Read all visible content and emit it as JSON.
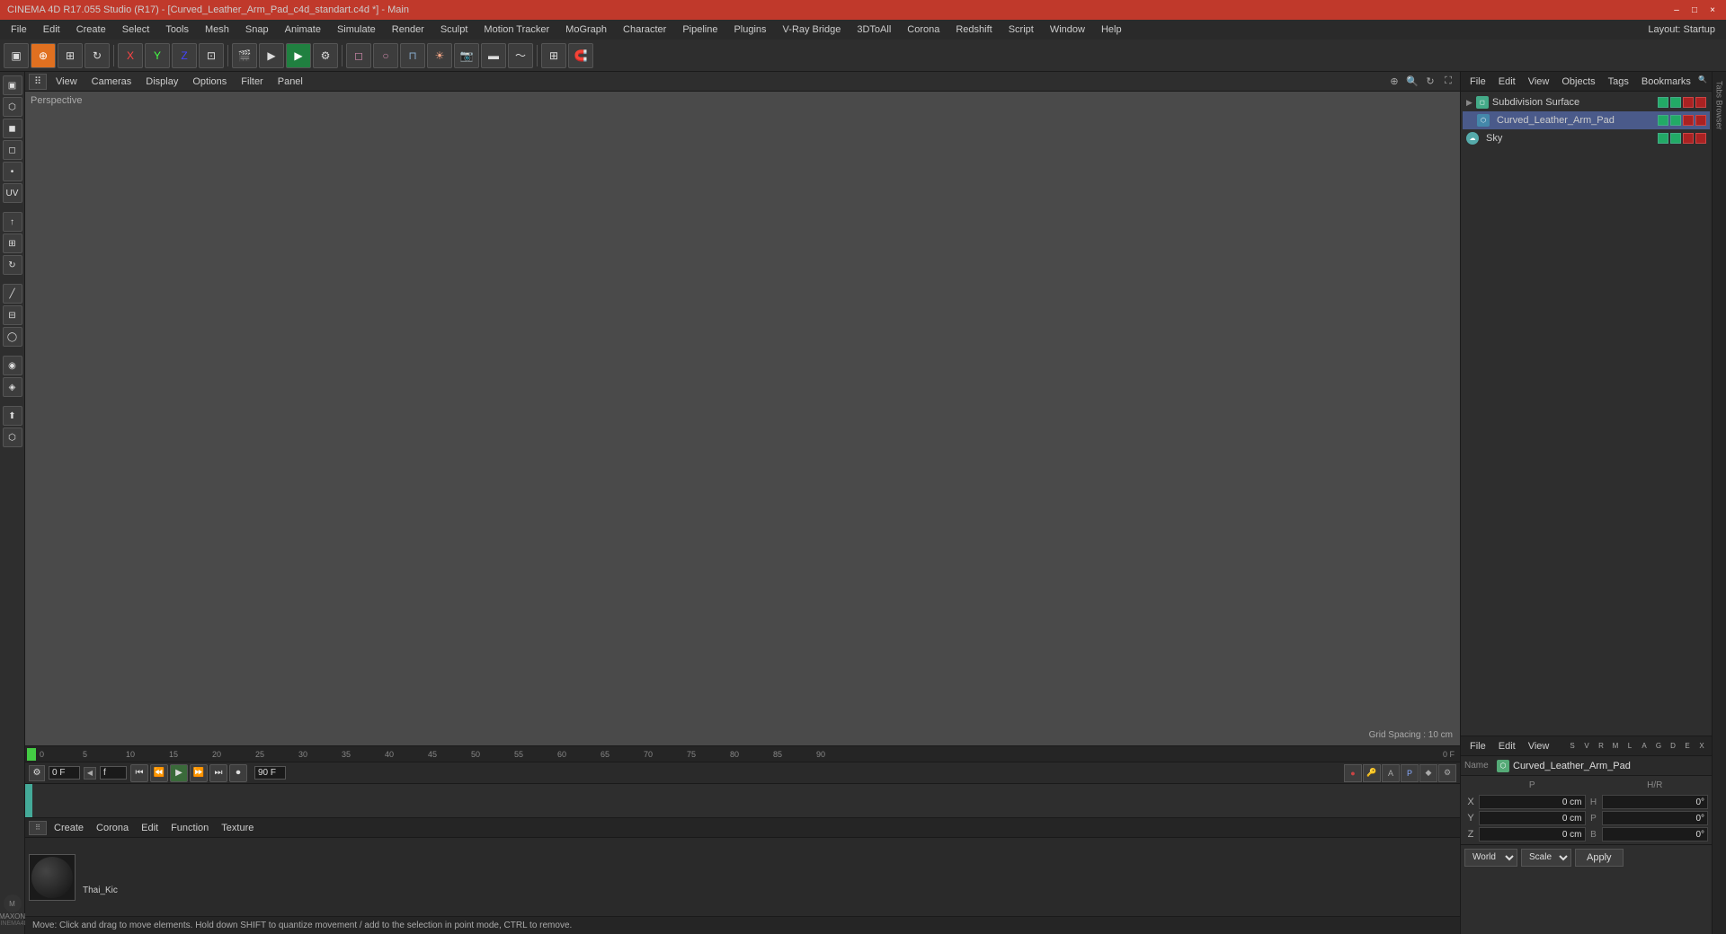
{
  "titlebar": {
    "title": "CINEMA 4D R17.055 Studio (R17) - [Curved_Leather_Arm_Pad_c4d_standart.c4d *] - Main",
    "minimize": "–",
    "maximize": "□",
    "close": "×"
  },
  "menubar": {
    "items": [
      "File",
      "Edit",
      "Create",
      "Select",
      "Tools",
      "Mesh",
      "Snap",
      "Animate",
      "Simulate",
      "Render",
      "Sculpt",
      "Motion Tracker",
      "MoGraph",
      "Character",
      "Pipeline",
      "Plugins",
      "V-Ray Bridge",
      "3DToAll",
      "Corona",
      "Redshift",
      "Script",
      "Window",
      "Help"
    ]
  },
  "layout": {
    "label": "Layout: Startup"
  },
  "viewport": {
    "label": "Perspective",
    "toolbar": [
      "View",
      "Cameras",
      "Display",
      "Options",
      "Filter",
      "Panel"
    ],
    "grid_spacing": "Grid Spacing : 10 cm"
  },
  "objects": {
    "toolbar": [
      "File",
      "Edit",
      "View",
      "Objects",
      "Tags",
      "Bookmarks"
    ],
    "items": [
      {
        "name": "Subdivision Surface",
        "indent": 0,
        "icon": "green"
      },
      {
        "name": "Curved_Leather_Arm_Pad",
        "indent": 1,
        "icon": "blue"
      },
      {
        "name": "Sky",
        "indent": 0,
        "icon": "sky"
      }
    ]
  },
  "attributes": {
    "toolbar": [
      "File",
      "Edit",
      "View"
    ],
    "name_label": "Name",
    "selected_object": "Curved_Leather_Arm_Pad",
    "columns": {
      "s": "S",
      "v": "V",
      "r": "R",
      "m": "M",
      "l": "L",
      "a": "A",
      "g": "G",
      "d": "D",
      "e": "E",
      "x": "X"
    },
    "position": {
      "x_label": "X",
      "x_pos": "0 cm",
      "h_label": "H",
      "h_val": "0°",
      "y_label": "Y",
      "y_pos": "0 cm",
      "p_label": "P",
      "p_val": "0°",
      "z_label": "Z",
      "z_pos": "0 cm",
      "b_label": "B",
      "b_val": "0°"
    },
    "coord_system": "World",
    "scale_label": "Scale",
    "apply_label": "Apply"
  },
  "timeline": {
    "frame_current": "0 F",
    "frame_end": "90 F",
    "frame_input": "f",
    "ruler_marks": [
      "0",
      "5",
      "10",
      "15",
      "20",
      "25",
      "30",
      "35",
      "40",
      "45",
      "50",
      "55",
      "60",
      "65",
      "70",
      "75",
      "80",
      "85",
      "90"
    ]
  },
  "material": {
    "toolbar": [
      "Create",
      "Corona",
      "Edit",
      "Function",
      "Texture"
    ],
    "thumbnail_name": "Thai_Kic"
  },
  "status": {
    "text": "Move: Click and drag to move elements. Hold down SHIFT to quantize movement / add to the selection in point mode, CTRL to remove."
  }
}
